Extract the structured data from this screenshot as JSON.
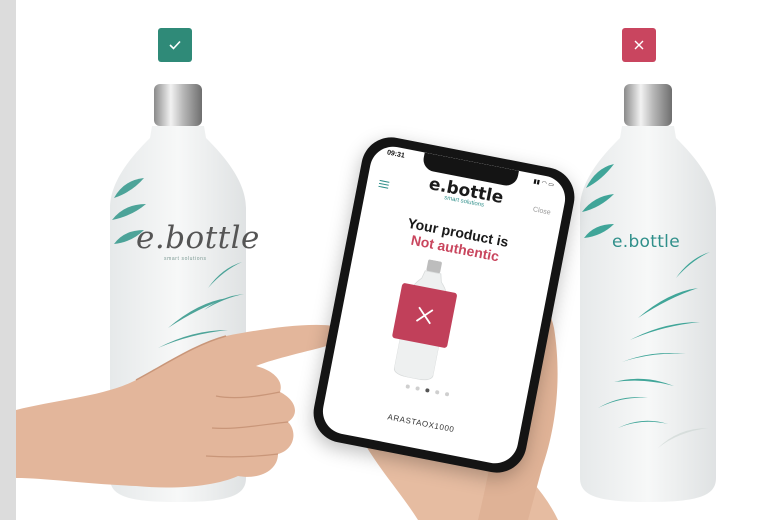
{
  "scene": {
    "description_colors": {
      "authentic_badge": "#2f8a78",
      "fake_badge": "#c9455f",
      "leaf_teal": "#2f9b8e",
      "alert_red": "#c1405a"
    }
  },
  "left_bottle": {
    "badge_icon": "checkmark-icon",
    "brand_script": "e.bottle",
    "brand_tagline": "smart solutions"
  },
  "right_bottle": {
    "badge_icon": "close-icon",
    "brand_text": "e.bottle"
  },
  "phone": {
    "status_time": "09:31",
    "status_icons": "▮▮ ◠ ▭",
    "logo_main": "e.bottle",
    "logo_sub": "smart solutions",
    "close_label": "Close",
    "verdict_line1": "Your product is",
    "verdict_line2": "Not authentic",
    "result_icon": "close-icon",
    "carousel_dots": 5,
    "carousel_active_index": 2,
    "serial": "ARASTAOX1000"
  }
}
